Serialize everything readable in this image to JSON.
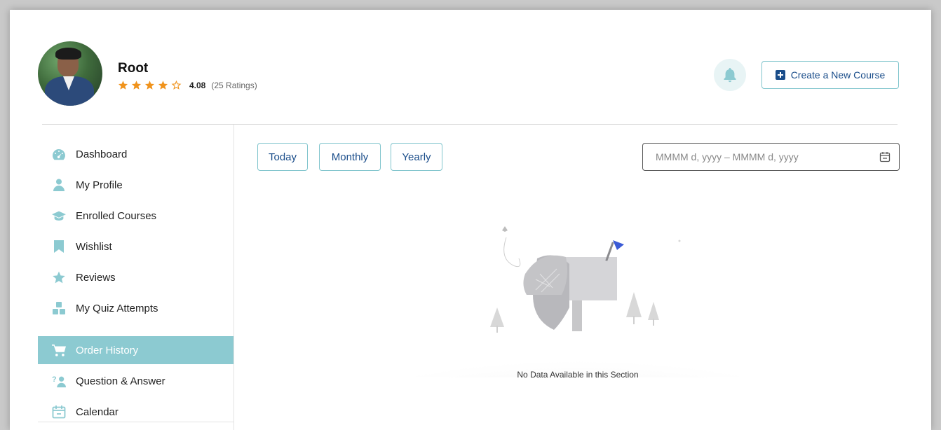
{
  "user": {
    "name": "Root",
    "rating_value": "4.08",
    "rating_count": "(25 Ratings)",
    "stars_filled": 4,
    "stars_total": 5
  },
  "header": {
    "create_course_label": "Create a New Course",
    "notification_icon": "bell-icon"
  },
  "sidebar": {
    "items": [
      {
        "label": "Dashboard",
        "icon": "dashboard-gauge-icon",
        "active": false
      },
      {
        "label": "My Profile",
        "icon": "user-icon",
        "active": false
      },
      {
        "label": "Enrolled Courses",
        "icon": "graduation-cap-icon",
        "active": false
      },
      {
        "label": "Wishlist",
        "icon": "bookmark-icon",
        "active": false
      },
      {
        "label": "Reviews",
        "icon": "star-icon",
        "active": false
      },
      {
        "label": "My Quiz Attempts",
        "icon": "quiz-blocks-icon",
        "active": false
      },
      {
        "label": "Order History",
        "icon": "cart-icon",
        "active": true
      },
      {
        "label": "Question & Answer",
        "icon": "question-person-icon",
        "active": false
      },
      {
        "label": "Calendar",
        "icon": "calendar-icon",
        "active": false
      }
    ]
  },
  "filters": {
    "today": "Today",
    "monthly": "Monthly",
    "yearly": "Yearly",
    "date_placeholder": "MMMM d, yyyy – MMMM d, yyyy"
  },
  "empty_state": {
    "message": "No Data Available in this Section"
  },
  "colors": {
    "accent": "#8ccad1",
    "primary_text": "#1a4d8a",
    "star": "#f0931c",
    "button_border": "#7fc4cc"
  }
}
